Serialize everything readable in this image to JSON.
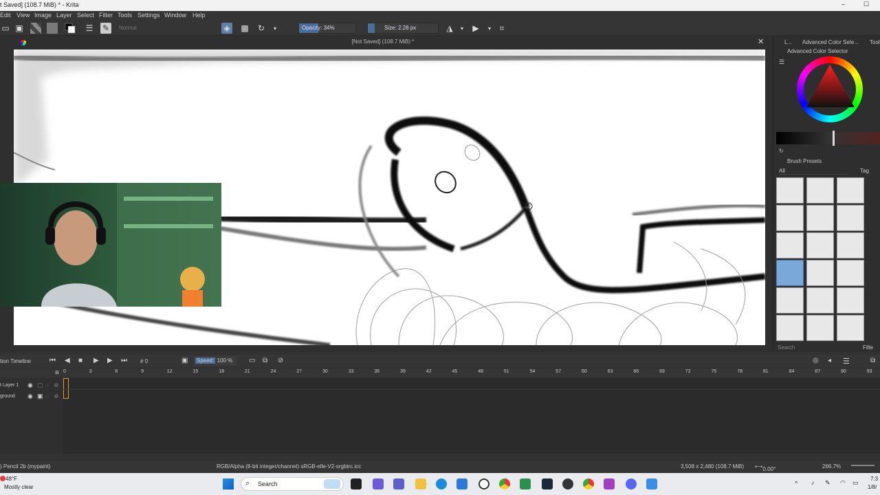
{
  "window": {
    "title": "t Saved]  (108.7 MiB) * - Krita",
    "minimize": "–",
    "maximize": "☐"
  },
  "menu": [
    "Edit",
    "View",
    "Image",
    "Layer",
    "Select",
    "Filter",
    "Tools",
    "Settings",
    "Window",
    "Help"
  ],
  "toolbar": {
    "blend_mode": "Normal",
    "opacity_label": "Opacity: 34%",
    "opacity_percent": 34,
    "size_label": "Size: 2.28 px"
  },
  "document": {
    "title": "[Not Saved]  (108.7 MiB) *",
    "close": "✕"
  },
  "dock": {
    "tab_short": "L...",
    "tab_active": "Advanced Color Sele...",
    "tab_tool": "Tool",
    "color_selector_title": "Advanced Color Selector",
    "brush_presets_title": "Brush Presets",
    "filter_all": "All",
    "tag_label": "Tag",
    "search_placeholder": "Search",
    "filter_label": "Filte"
  },
  "timeline": {
    "title": "tion Timeline",
    "frame_value": "0",
    "frame_prefix": "#",
    "speed_label": "Speed:",
    "speed_value": "100 %",
    "ticks": [
      "0",
      "3",
      "6",
      "9",
      "12",
      "15",
      "18",
      "21",
      "24",
      "27",
      "30",
      "33",
      "36",
      "39",
      "42",
      "45",
      "48",
      "51",
      "54",
      "57",
      "60",
      "63",
      "66",
      "69",
      "72",
      "75",
      "78",
      "81",
      "84",
      "87",
      "90",
      "93"
    ],
    "layers": [
      {
        "name": "t Layer 1"
      },
      {
        "name": "ground"
      }
    ]
  },
  "status": {
    "brush": ") Pencil 2b (mypaint)",
    "color_space": "RGB/Alpha (8-bit integer/channel)  sRGB-elle-V2-srgbtrc.icc",
    "dimensions": "3,508 x 2,480 (108.7 MiB)",
    "rotation": "0.00°",
    "zoom": "266.7%"
  },
  "taskbar": {
    "weather_temp": "48°F",
    "weather_desc": "Mostly clear",
    "search_label": "Search",
    "time": "7:3",
    "date": "1/8/"
  },
  "colors": {
    "accent": "#4a6d9a",
    "active_preset": "#7aa8d8",
    "frame_marker": "#e0a030"
  }
}
